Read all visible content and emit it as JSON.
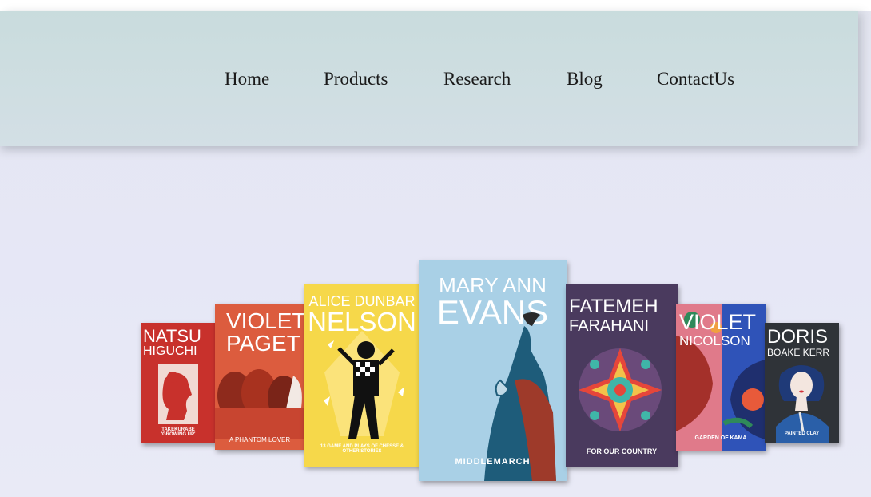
{
  "nav": {
    "items": [
      {
        "label": "Home"
      },
      {
        "label": "Products"
      },
      {
        "label": "Research"
      },
      {
        "label": "Blog"
      },
      {
        "label": "ContactUs"
      }
    ]
  },
  "books": [
    {
      "author_line1": "NATSU",
      "author_line2": "HIGUCHI",
      "title": "TAKEKURABE 'GROWING UP'",
      "color": "#c8312c"
    },
    {
      "author_line1": "VIOLET",
      "author_line2": "PAGET",
      "title": "A PHANTOM LOVER",
      "color": "#dc5c3e"
    },
    {
      "author_line1": "ALICE DUNBAR",
      "author_line2": "NELSON",
      "title": "13 GAME AND PLAYS OF CHESSE & OTHER STORIES",
      "color": "#f6d84a"
    },
    {
      "author_line1": "MARY ANN",
      "author_line2": "EVANS",
      "title": "MIDDLEMARCH",
      "color": "#a9d0e6"
    },
    {
      "author_line1": "FATEMEH",
      "author_line2": "FARAHANI",
      "title": "FOR OUR COUNTRY",
      "color": "#4a3a5e"
    },
    {
      "author_line1": "VIOLET",
      "author_line2": "NICOLSON",
      "title": "GARDEN OF KAMA",
      "color": "#2f53b8"
    },
    {
      "author_line1": "DORIS",
      "author_line2": "BOAKE KERR",
      "title": "PAINTED CLAY",
      "color": "#2f3338"
    }
  ]
}
